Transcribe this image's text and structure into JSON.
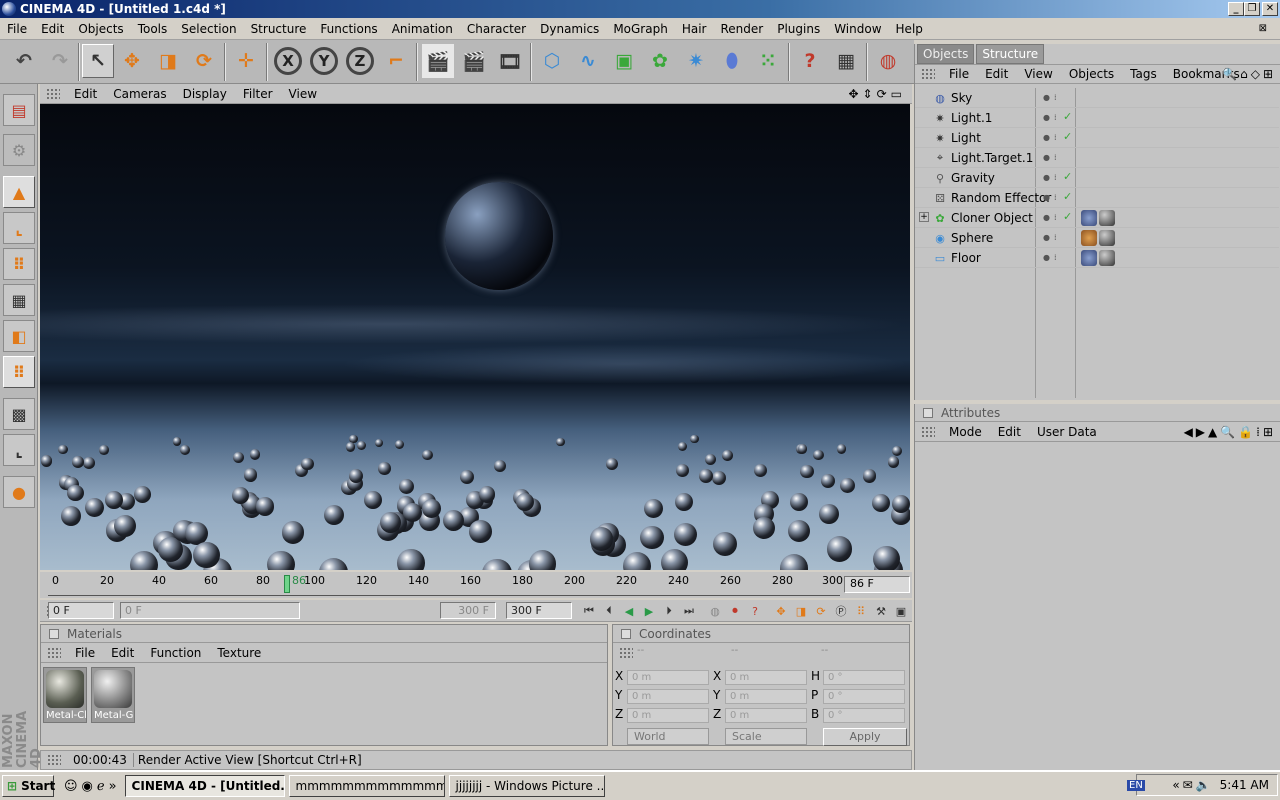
{
  "window": {
    "title": "CINEMA 4D - [Untitled 1.c4d *]",
    "min_label": "_",
    "max_label": "❐",
    "close_label": "✕"
  },
  "menubar": [
    "File",
    "Edit",
    "Objects",
    "Tools",
    "Selection",
    "Structure",
    "Functions",
    "Animation",
    "Character",
    "Dynamics",
    "MoGraph",
    "Hair",
    "Render",
    "Plugins",
    "Window",
    "Help"
  ],
  "toolbar": {
    "axis_x": "X",
    "axis_y": "Y",
    "axis_z": "Z"
  },
  "viewport": {
    "menu": [
      "Edit",
      "Cameras",
      "Display",
      "Filter",
      "View"
    ]
  },
  "timeline": {
    "ticks": [
      "0",
      "20",
      "40",
      "60",
      "80",
      "100",
      "120",
      "140",
      "160",
      "180",
      "200",
      "220",
      "240",
      "260",
      "280",
      "300"
    ],
    "playhead_label": "86",
    "current_frame": "86 F"
  },
  "transport": {
    "start_field": "0 F",
    "range_start": "0 F",
    "range_end": "300 F",
    "end_field": "300 F"
  },
  "materials": {
    "title": "Materials",
    "menu": [
      "File",
      "Edit",
      "Function",
      "Texture"
    ],
    "items": [
      {
        "name": "Metal-Ch"
      },
      {
        "name": "Metal-Gl"
      }
    ]
  },
  "coordinates": {
    "title": "Coordinates",
    "col_headers": [
      "--",
      "--",
      "--"
    ],
    "pos_labels": [
      "X",
      "Y",
      "Z"
    ],
    "size_labels": [
      "X",
      "Y",
      "Z"
    ],
    "rot_labels": [
      "H",
      "P",
      "B"
    ],
    "pos_values": [
      "0 m",
      "0 m",
      "0 m"
    ],
    "size_values": [
      "0 m",
      "0 m",
      "0 m"
    ],
    "rot_values": [
      "0 °",
      "0 °",
      "0 °"
    ],
    "mode_select": "World",
    "size_select": "Scale",
    "apply_label": "Apply"
  },
  "status": {
    "time": "00:00:43",
    "message": "Render Active View [Shortcut Ctrl+R]"
  },
  "objects_panel": {
    "tabs": [
      "Objects",
      "Structure"
    ],
    "menu": [
      "File",
      "Edit",
      "View",
      "Objects",
      "Tags",
      "Bookmarks"
    ],
    "items": [
      {
        "name": "Sky",
        "icon": "sky-icon"
      },
      {
        "name": "Light.1",
        "icon": "light-icon"
      },
      {
        "name": "Light",
        "icon": "light-icon"
      },
      {
        "name": "Light.Target.1",
        "icon": "target-icon"
      },
      {
        "name": "Gravity",
        "icon": "gravity-icon"
      },
      {
        "name": "Random Effector",
        "icon": "effector-icon"
      },
      {
        "name": "Cloner Object",
        "icon": "cloner-icon"
      },
      {
        "name": "Sphere",
        "icon": "sphere-icon"
      },
      {
        "name": "Floor",
        "icon": "floor-icon"
      }
    ]
  },
  "attributes_panel": {
    "title": "Attributes",
    "menu": [
      "Mode",
      "Edit",
      "User Data"
    ]
  },
  "maxon_logo": "MAXON CINEMA 4D",
  "taskbar": {
    "start": "Start",
    "items": [
      {
        "label": "CINEMA 4D - [Untitled..."
      },
      {
        "label": "mmmmmmmmmmmmmm..."
      },
      {
        "label": "jjjjjjjj - Windows Picture ..."
      }
    ],
    "lang": "EN",
    "clock": "5:41 AM"
  }
}
